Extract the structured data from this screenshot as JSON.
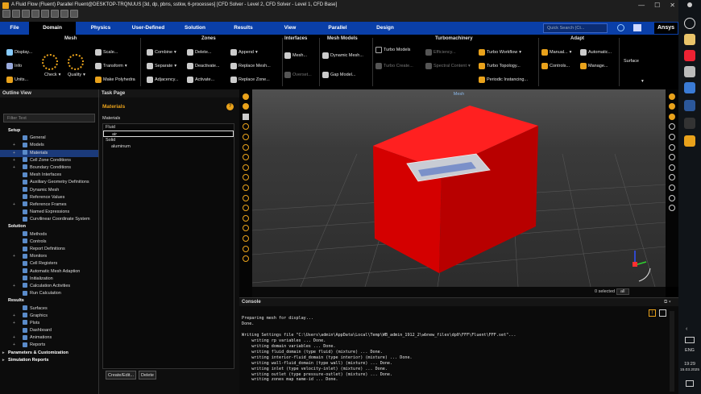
{
  "window": {
    "title": "A Fluid Flow (Fluent) Parallel Fluent@DESKTOP-TRQNUUS  [3d, dp, pbns, sstkw, 6-processes] [CFD Solver - Level 2, CFD Solver - Level 1, CFD Base]"
  },
  "tabs": [
    "File",
    "Domain",
    "Physics",
    "User-Defined",
    "Solution",
    "Results",
    "View",
    "Parallel",
    "Design"
  ],
  "active_tab": "Domain",
  "quick_search": {
    "placeholder": "Quick Search (Ct..."
  },
  "brand": "Ansys",
  "ribbon": {
    "mesh": {
      "label": "Mesh",
      "display": "Display...",
      "info": "Info",
      "units": "Units...",
      "check": "Check",
      "quality": "Quality",
      "scale": "Scale...",
      "transform": "Transform",
      "polyhedra": "Make Polyhedra"
    },
    "zones": {
      "label": "Zones",
      "combine": "Combine",
      "separate": "Separate",
      "adjacency": "Adjacency...",
      "delete": "Delete...",
      "deactivate": "Deactivate...",
      "activate": "Activate...",
      "append": "Append",
      "replace_mesh": "Replace Mesh...",
      "replace_zone": "Replace Zone..."
    },
    "interfaces": {
      "label": "Interfaces",
      "mesh": "Mesh...",
      "overset": "Overset..."
    },
    "mesh_models": {
      "label": "Mesh Models",
      "dynamic": "Dynamic Mesh...",
      "gap": "Gap Model..."
    },
    "turbo": {
      "label": "Turbomachinery",
      "models": "Turbo Models",
      "create": "Turbo Create...",
      "efficiency": "Efficiency...",
      "spectral": "Spectral Content",
      "workflow": "Turbo Workflow",
      "topology": "Turbo Topology...",
      "periodic": "Periodic Instancing..."
    },
    "adapt": {
      "label": "Adapt",
      "manual": "Manual...",
      "automatic": "Automatic...",
      "controls": "Controls...",
      "manage": "Manage...",
      "surface": "Surface"
    }
  },
  "outline": {
    "title": "Outline View",
    "filter_placeholder": "Filter Text",
    "items": [
      {
        "label": "Setup",
        "level": 0,
        "section": true
      },
      {
        "label": "General",
        "level": 1
      },
      {
        "label": "Models",
        "level": 1,
        "expand": true
      },
      {
        "label": "Materials",
        "level": 1,
        "expand": true,
        "selected": true
      },
      {
        "label": "Cell Zone Conditions",
        "level": 1,
        "expand": true
      },
      {
        "label": "Boundary Conditions",
        "level": 1,
        "expand": true
      },
      {
        "label": "Mesh Interfaces",
        "level": 1
      },
      {
        "label": "Auxiliary Geometry Definitions",
        "level": 1
      },
      {
        "label": "Dynamic Mesh",
        "level": 1
      },
      {
        "label": "Reference Values",
        "level": 1
      },
      {
        "label": "Reference Frames",
        "level": 1,
        "expand": true
      },
      {
        "label": "Named Expressions",
        "level": 1
      },
      {
        "label": "Curvilinear Coordinate System",
        "level": 1
      },
      {
        "label": "Solution",
        "level": 0,
        "section": true
      },
      {
        "label": "Methods",
        "level": 1
      },
      {
        "label": "Controls",
        "level": 1
      },
      {
        "label": "Report Definitions",
        "level": 1
      },
      {
        "label": "Monitors",
        "level": 1,
        "expand": true
      },
      {
        "label": "Cell Registers",
        "level": 1
      },
      {
        "label": "Automatic Mesh Adaption",
        "level": 1
      },
      {
        "label": "Initialization",
        "level": 1
      },
      {
        "label": "Calculation Activities",
        "level": 1,
        "expand": true
      },
      {
        "label": "Run Calculation",
        "level": 1
      },
      {
        "label": "Results",
        "level": 0,
        "section": true
      },
      {
        "label": "Surfaces",
        "level": 1
      },
      {
        "label": "Graphics",
        "level": 1,
        "expand": true
      },
      {
        "label": "Plots",
        "level": 1,
        "expand": true
      },
      {
        "label": "Dashboard",
        "level": 1
      },
      {
        "label": "Animations",
        "level": 1,
        "expand": true
      },
      {
        "label": "Reports",
        "level": 1,
        "expand": true
      },
      {
        "label": "Parameters & Customization",
        "level": 0,
        "section": true,
        "expand": true
      },
      {
        "label": "Simulation Reports",
        "level": 0,
        "section": true,
        "expand": true
      }
    ]
  },
  "task_page": {
    "title": "Task Page",
    "heading": "Materials",
    "list_label": "Materials",
    "materials": [
      {
        "label": "Fluid",
        "level": 0
      },
      {
        "label": "air",
        "level": 1,
        "selected": true
      },
      {
        "label": "Solid",
        "level": 0
      },
      {
        "label": "aluminum",
        "level": 1
      }
    ],
    "create_edit": "Create/Edit...",
    "delete": "Delete"
  },
  "graphics": {
    "title": "Mesh",
    "status": "0 selected",
    "status_select": "all"
  },
  "console": {
    "title": "Console",
    "lines": [
      "Preparing mesh for display...",
      "Done.",
      "",
      "Writing Settings file \"C:\\Users\\admin\\AppData\\Local\\Temp\\WB_admin_1912_2\\wbnew_files\\dp0\\FFF\\Fluent\\FFF.set\"...",
      "    writing rp variables ... Done.",
      "    writing domain variables ... Done.",
      "    writing fluid_domain (type fluid) (mixture) ... Done.",
      "    writing interior-fluid_domain (type interior) (mixture) ... Done.",
      "    writing wall-fluid_domain (type wall) (mixture) ... Done.",
      "    writing inlet (type velocity-inlet) (mixture) ... Done.",
      "    writing outlet (type pressure-outlet) (mixture) ... Done.",
      "    writing zones map name-id ... Done."
    ]
  },
  "taskbar": {
    "time": "19:29",
    "date": "15.03.2025",
    "lang": "ENG"
  },
  "colors": {
    "ribbon_tab_bg": "#0a3fa8",
    "box_red": "#e00000",
    "accent_orange": "#e9a21b"
  }
}
